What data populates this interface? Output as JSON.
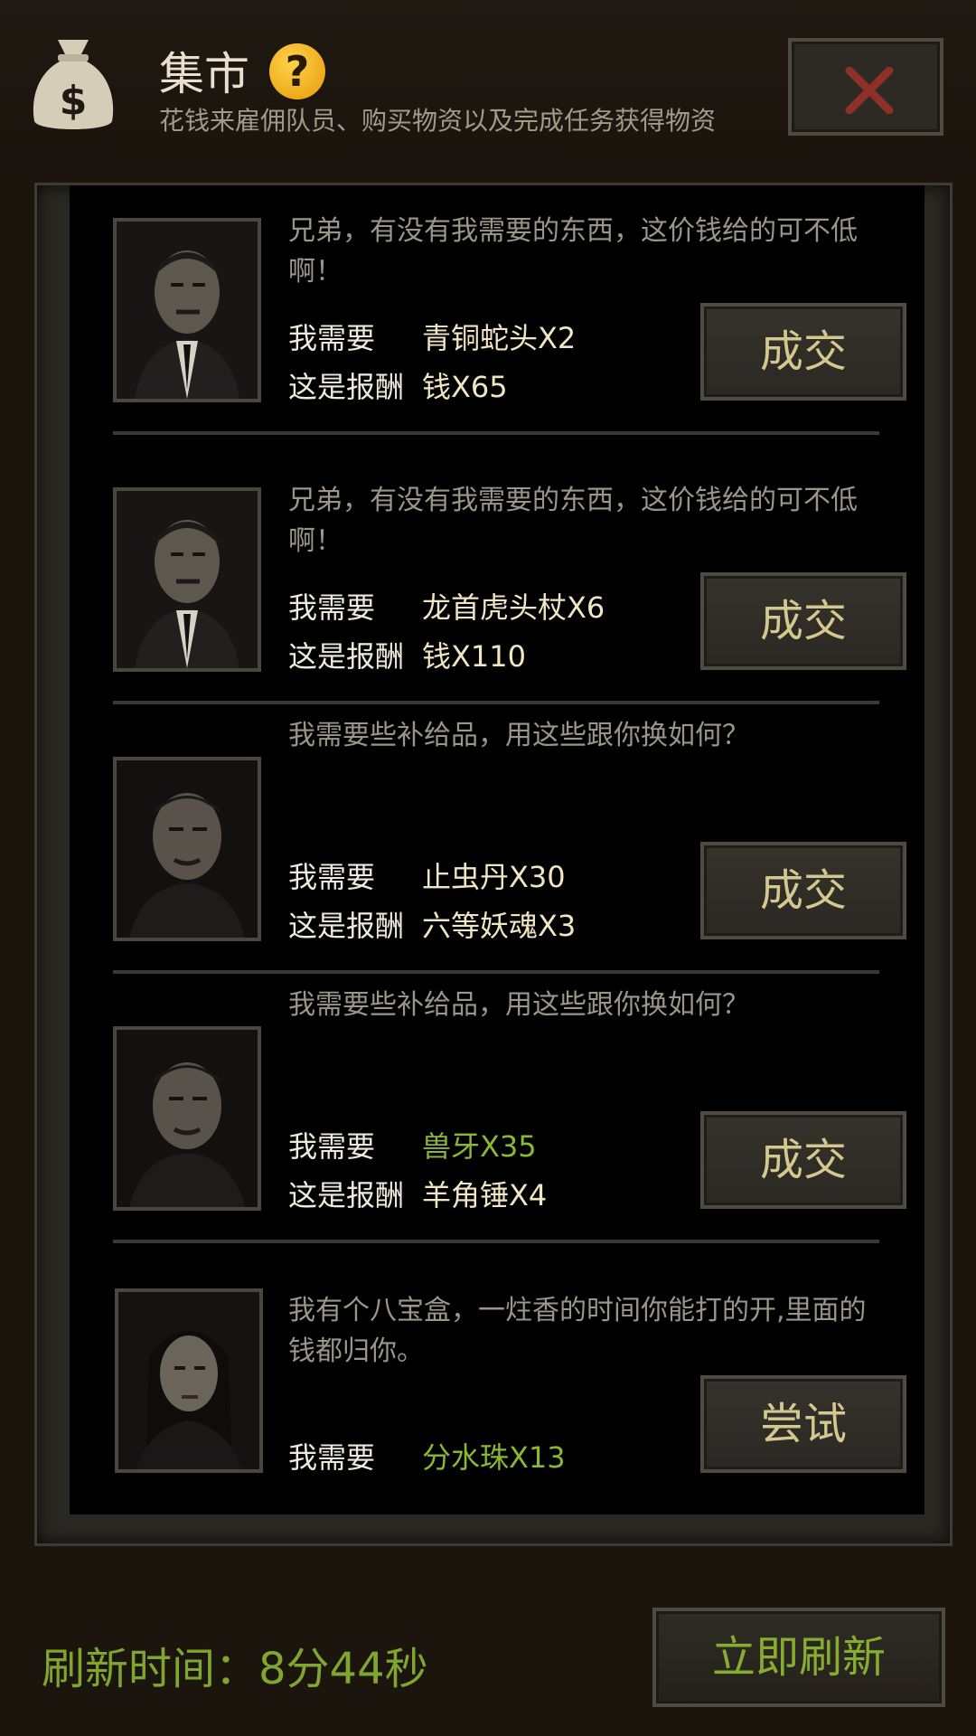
{
  "header": {
    "title": "集市",
    "help_icon": "?",
    "subtitle": "花钱来雇佣队员、购买物资以及完成任务获得物资",
    "bag_icon_glyph": "$",
    "icons": [
      "money-bag-icon",
      "help-icon",
      "close-icon"
    ]
  },
  "trades": [
    {
      "quote": "兄弟，有没有我需要的东西，这价钱给的可不低啊！",
      "need_label": "我需要",
      "need_value": "青铜蛇头X2",
      "reward_label": "这是报酬",
      "reward_value": "钱X65",
      "button": "成交",
      "need_color": "#f0e6c4"
    },
    {
      "quote": "兄弟，有没有我需要的东西，这价钱给的可不低啊！",
      "need_label": "我需要",
      "need_value": "龙首虎头杖X6",
      "reward_label": "这是报酬",
      "reward_value": "钱X110",
      "button": "成交",
      "need_color": "#f0e6c4"
    },
    {
      "quote": "我需要些补给品，用这些跟你换如何？",
      "need_label": "我需要",
      "need_value": "止虫丹X30",
      "reward_label": "这是报酬",
      "reward_value": "六等妖魂X3",
      "button": "成交",
      "need_color": "#f0e6c4"
    },
    {
      "quote": "我需要些补给品，用这些跟你换如何？",
      "need_label": "我需要",
      "need_value": "兽牙X35",
      "reward_label": "这是报酬",
      "reward_value": "羊角锤X4",
      "button": "成交",
      "need_color": "#8bb832"
    },
    {
      "quote": "我有个八宝盒，一炷香的时间你能打的开,里面的钱都归你。",
      "need_label": "我需要",
      "need_value": "分水珠X13",
      "button": "尝试",
      "need_color": "#8bb832"
    }
  ],
  "footer": {
    "refresh_text": "刷新时间：8分44秒",
    "refresh_button": "立即刷新"
  }
}
